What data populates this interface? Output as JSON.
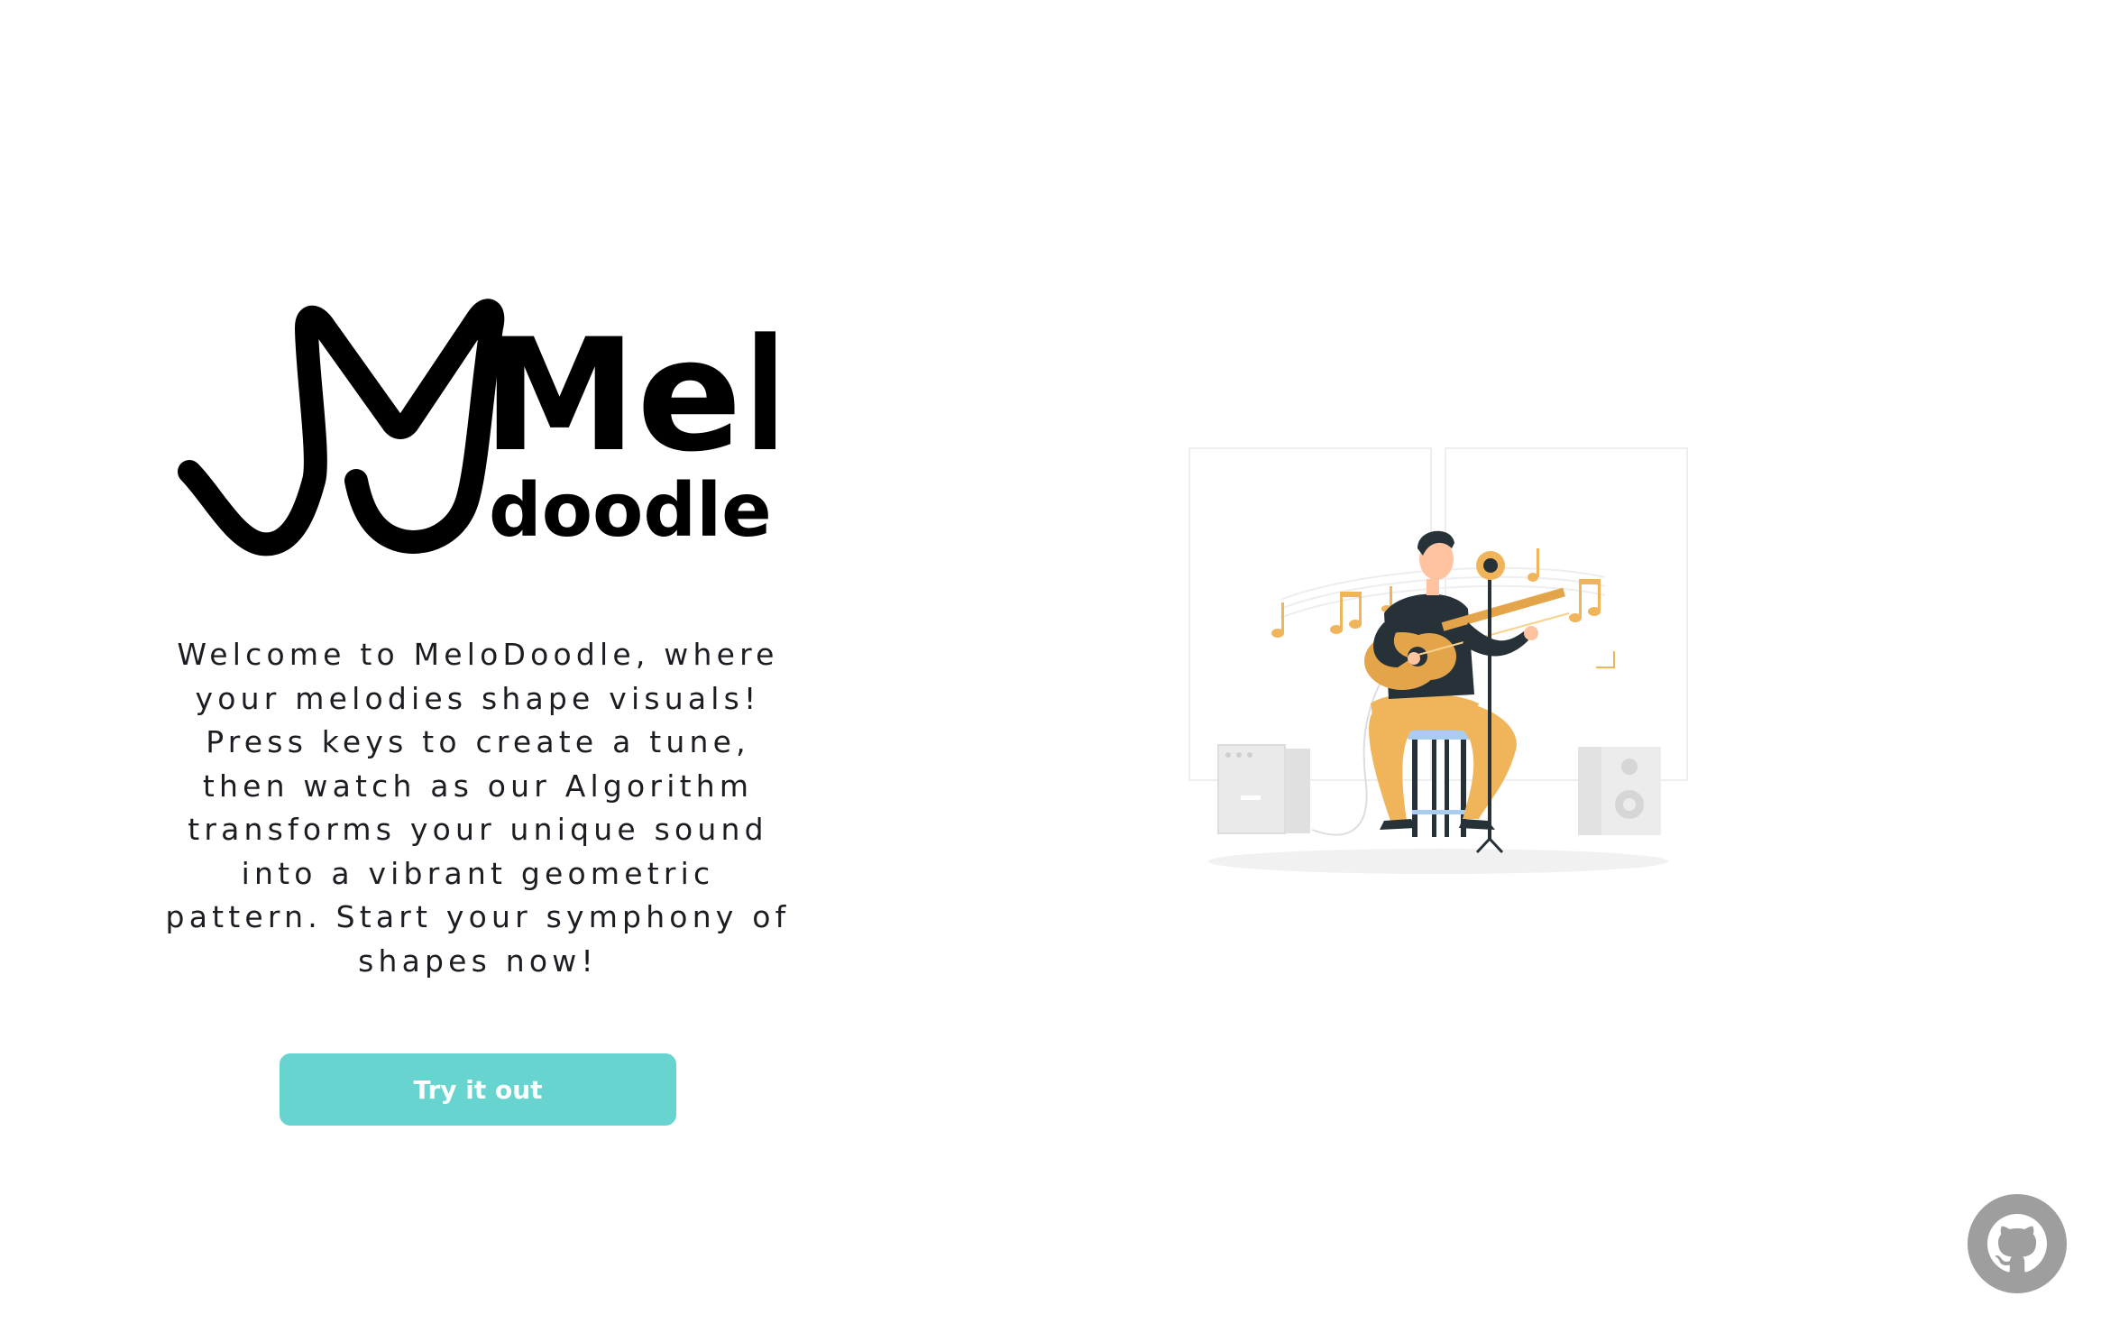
{
  "logo": {
    "word_top": "Melo",
    "word_bottom": "doodle"
  },
  "hero": {
    "description": "Welcome to MeloDoodle, where your melodies shape visuals! Press keys to create a tune, then watch as our Algorithm transforms your unique sound into a vibrant geometric pattern. Start your symphony of shapes now!",
    "cta_label": "Try it out"
  },
  "illustration": {
    "icon": "guitarist-illustration"
  },
  "github": {
    "icon": "github-icon"
  },
  "colors": {
    "accent": "#67d4cf",
    "text": "#1c1c22",
    "github_bg": "#9e9e9e",
    "illustration_orange": "#f0b55a"
  }
}
